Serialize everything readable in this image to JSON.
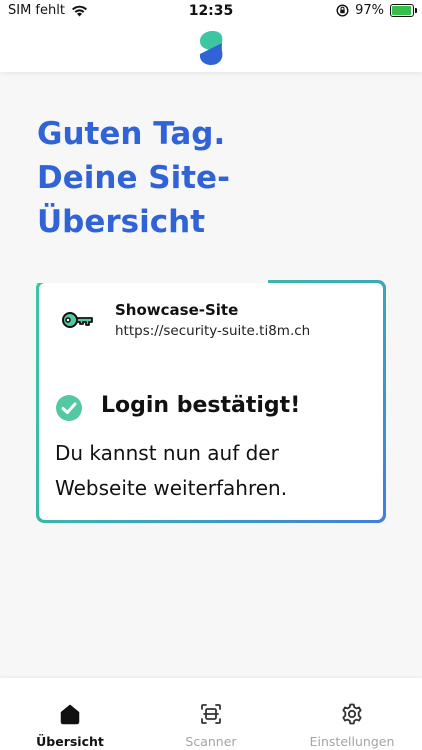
{
  "status_bar": {
    "carrier": "SIM fehlt",
    "time": "12:35",
    "battery_percent": "97%",
    "battery_level": 0.97
  },
  "header": {
    "logo_icon": "s-logo-icon"
  },
  "greeting": {
    "line1": "Guten Tag.",
    "line2": "Deine Site-",
    "line3": "Übersicht"
  },
  "site_card": {
    "site_name": "Showcase-Site",
    "site_url": "https://security-suite.ti8m.ch",
    "status_title": "Login bestätigt!",
    "status_text": "Du kannst nun auf der Webseite weiterfahren."
  },
  "tabs": [
    {
      "label": "Übersicht",
      "icon": "home-icon",
      "active": true
    },
    {
      "label": "Scanner",
      "icon": "scan-icon",
      "active": false
    },
    {
      "label": "Einstellungen",
      "icon": "gear-icon",
      "active": false
    }
  ],
  "colors": {
    "accent_blue": "#2f63d6",
    "accent_teal": "#3cc6a3",
    "check_green": "#52c9a3",
    "battery_green": "#35c04a"
  }
}
